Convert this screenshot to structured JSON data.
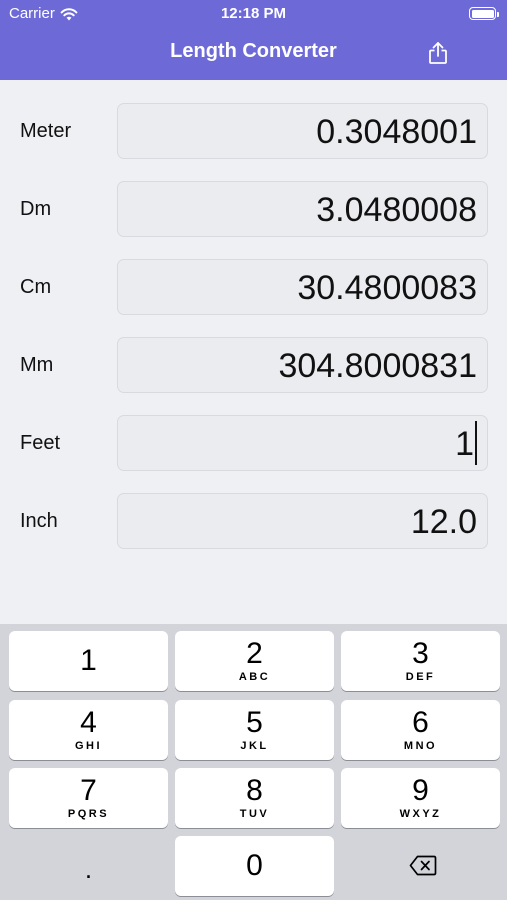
{
  "status_bar": {
    "carrier": "Carrier",
    "time": "12:18 PM"
  },
  "nav": {
    "title": "Length Converter",
    "share_icon": "share-icon"
  },
  "rows": [
    {
      "label": "Meter",
      "value": "0.3048001"
    },
    {
      "label": "Dm",
      "value": "3.0480008"
    },
    {
      "label": "Cm",
      "value": "30.4800083"
    },
    {
      "label": "Mm",
      "value": "304.8000831"
    },
    {
      "label": "Feet",
      "value": "1"
    },
    {
      "label": "Inch",
      "value": "12.0"
    }
  ],
  "focused_field": "Feet",
  "keypad": {
    "keys": [
      {
        "digit": "1",
        "letters": ""
      },
      {
        "digit": "2",
        "letters": "ABC"
      },
      {
        "digit": "3",
        "letters": "DEF"
      },
      {
        "digit": "4",
        "letters": "GHI"
      },
      {
        "digit": "5",
        "letters": "JKL"
      },
      {
        "digit": "6",
        "letters": "MNO"
      },
      {
        "digit": "7",
        "letters": "PQRS"
      },
      {
        "digit": "8",
        "letters": "TUV"
      },
      {
        "digit": "9",
        "letters": "WXYZ"
      }
    ],
    "dot": ".",
    "zero": "0",
    "backspace_icon": "backspace-icon"
  },
  "colors": {
    "nav_background": "#6d6ad8",
    "page_background": "#eff0f4",
    "keypad_background": "#d2d4da"
  }
}
